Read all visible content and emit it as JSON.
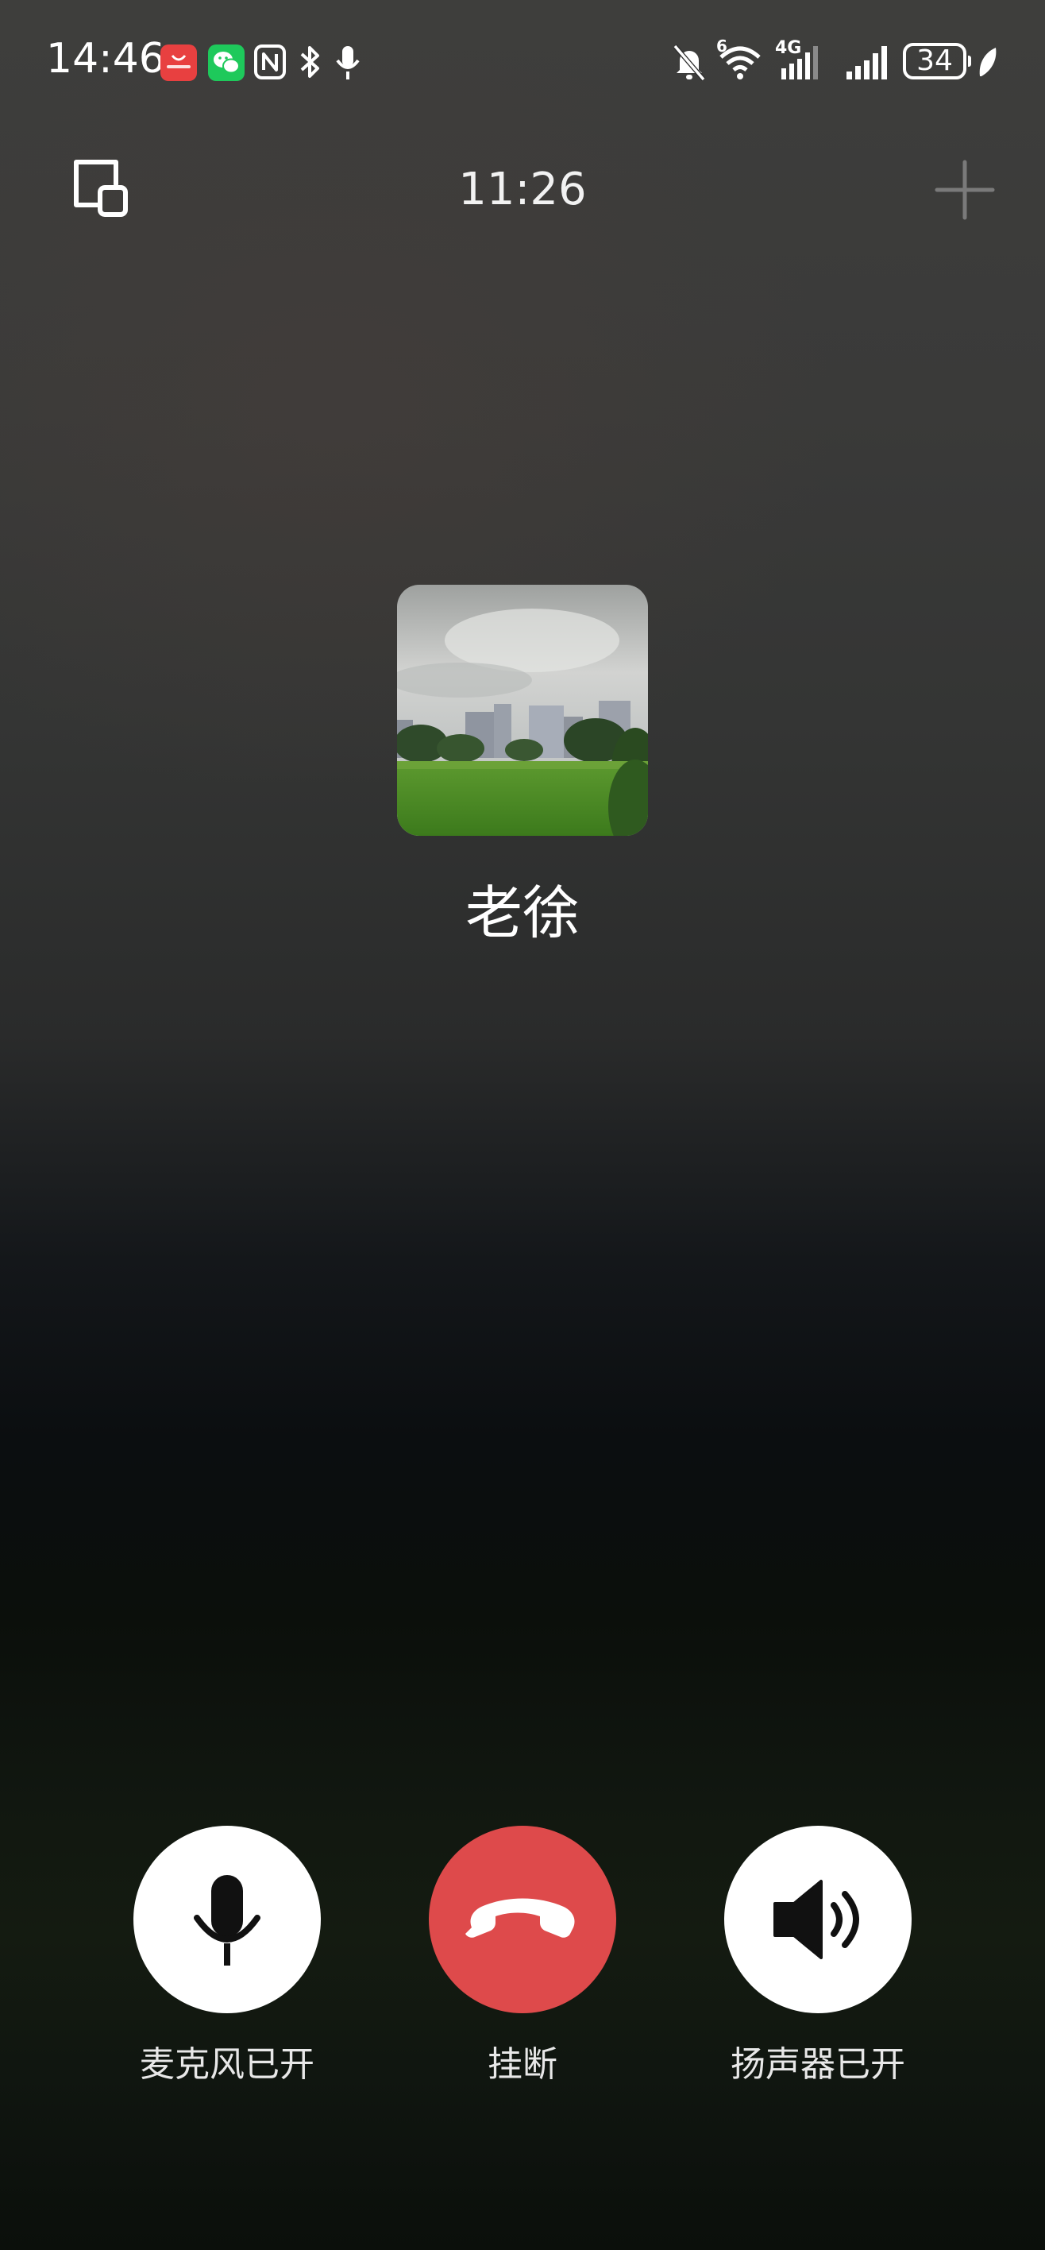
{
  "status_bar": {
    "time": "14:46",
    "left_icons": [
      "huawei-appgallery-icon",
      "wechat-icon",
      "nfc-icon",
      "bluetooth-icon",
      "microphone-icon"
    ],
    "right_icons": [
      "bell-muted-icon",
      "wifi-6-icon",
      "4g-signal-icon",
      "signal-icon",
      "battery-icon",
      "leaf-icon"
    ],
    "network_label": "4G",
    "wifi_label": "6",
    "battery_level": "34"
  },
  "call": {
    "duration": "11:26",
    "minimize_icon": "picture-in-picture-icon",
    "add_icon": "plus-icon"
  },
  "contact": {
    "name": "老徐",
    "avatar_description_icon": "avatar-landscape-photo"
  },
  "controls": {
    "mic": {
      "label": "麦克风已开",
      "icon": "microphone-icon",
      "color": "#ffffff"
    },
    "hangup": {
      "label": "挂断",
      "icon": "phone-hangup-icon",
      "color": "#de4a4b"
    },
    "speaker": {
      "label": "扬声器已开",
      "icon": "speaker-icon",
      "color": "#ffffff"
    }
  }
}
